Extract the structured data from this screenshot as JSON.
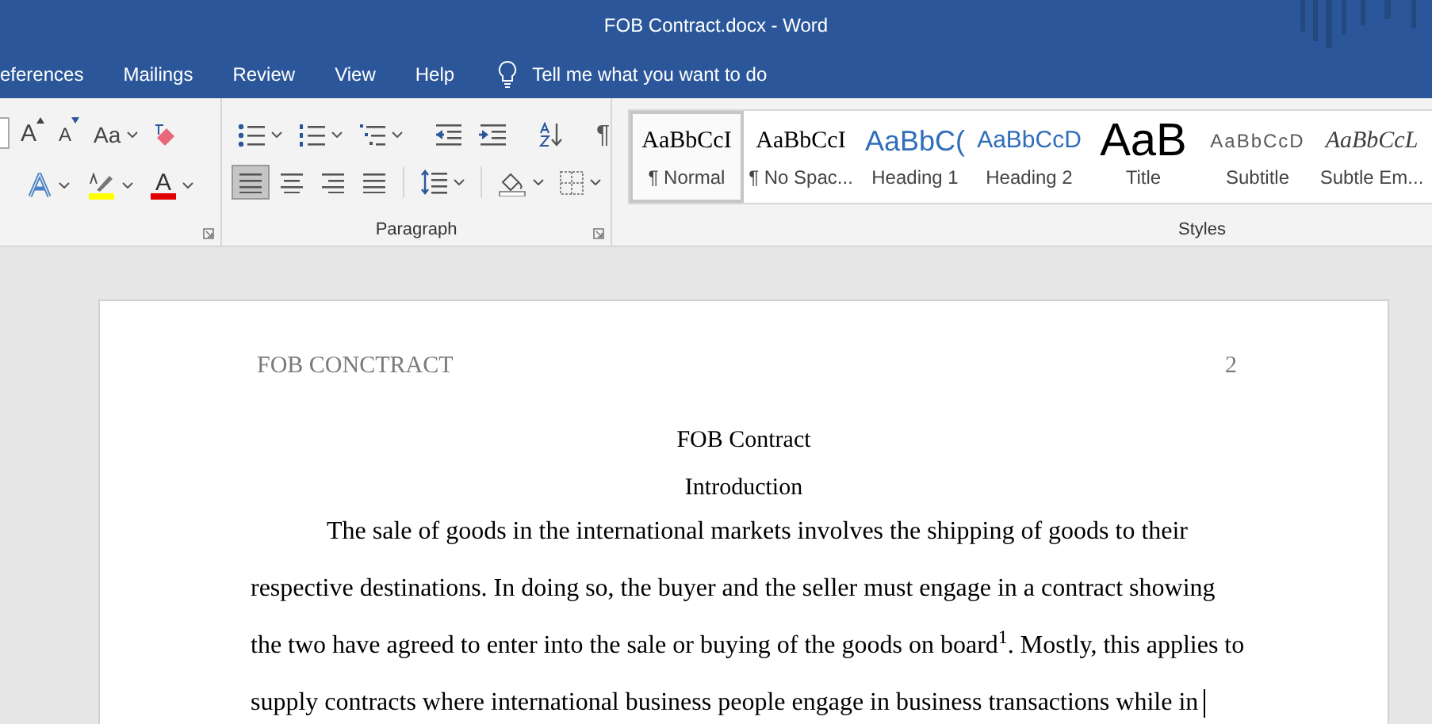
{
  "window": {
    "title": "FOB Contract.docx  -  Word"
  },
  "tabs": [
    {
      "label": "eferences",
      "selected": false
    },
    {
      "label": "Mailings",
      "selected": false
    },
    {
      "label": "Review",
      "selected": false
    },
    {
      "label": "View",
      "selected": false
    },
    {
      "label": "Help",
      "selected": false
    }
  ],
  "tell_me": {
    "placeholder": "Tell me what you want to do"
  },
  "font_group": {
    "row1": [
      {
        "kind": "grow",
        "glyph": "A"
      },
      {
        "kind": "shrink",
        "glyph": "A"
      },
      {
        "kind": "case",
        "glyph": "Aa"
      },
      {
        "kind": "clear"
      }
    ],
    "row2": [
      {
        "kind": "effects"
      },
      {
        "kind": "highlight"
      },
      {
        "kind": "color",
        "glyph": "A"
      }
    ]
  },
  "paragraph_group": {
    "label": "Paragraph",
    "row1": [
      {
        "kind": "bullets"
      },
      {
        "kind": "numbering"
      },
      {
        "kind": "multilevel"
      },
      {
        "kind": "outdent"
      },
      {
        "kind": "indent"
      },
      {
        "kind": "sort"
      },
      {
        "kind": "marks",
        "glyph": "¶"
      }
    ],
    "row2": [
      {
        "kind": "align_left",
        "selected": true
      },
      {
        "kind": "center",
        "selected": false
      },
      {
        "kind": "align_right",
        "selected": false
      },
      {
        "kind": "justify",
        "selected": false
      },
      {
        "kind": "line_spacing"
      },
      {
        "kind": "shading"
      },
      {
        "kind": "borders"
      }
    ]
  },
  "styles_group": {
    "label": "Styles",
    "items": [
      {
        "kind": "normal",
        "preview": "AaBbCcI",
        "name": "¶ Normal",
        "selected": true
      },
      {
        "kind": "no_spacing",
        "preview": "AaBbCcI",
        "name": "¶ No Spac...",
        "selected": false
      },
      {
        "kind": "heading1",
        "preview": "AaBbC(",
        "name": "Heading 1",
        "selected": false
      },
      {
        "kind": "heading2",
        "preview": "AaBbCcD",
        "name": "Heading 2",
        "selected": false
      },
      {
        "kind": "title",
        "preview": "AaB",
        "name": "Title",
        "selected": false
      },
      {
        "kind": "subtitle",
        "preview": "AaBbCcD",
        "name": "Subtitle",
        "selected": false
      },
      {
        "kind": "emphasis",
        "preview": "AaBbCcL",
        "name": "Subtle Em...",
        "selected": false
      }
    ]
  },
  "document": {
    "header": {
      "title": "FOB CONCTRACT",
      "page": "2"
    },
    "heading": "FOB Contract",
    "subheading": "Introduction",
    "paragraph": "The sale of goods in the international markets involves the shipping of goods to their respective destinations. In doing so, the buyer and the seller must engage in a contract showing the two have agreed to enter into the sale or buying of the goods on board$^{1}$. Mostly, this applies to supply contracts where international business people engage in business transactions while in"
  }
}
